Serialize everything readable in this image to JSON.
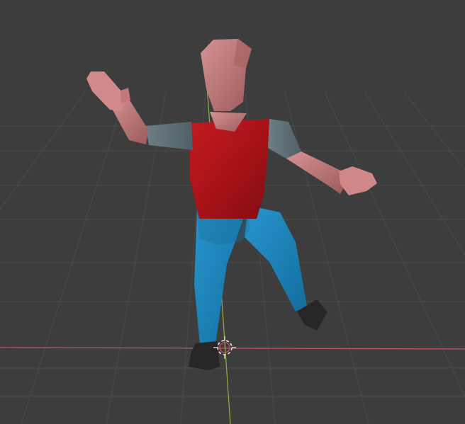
{
  "viewport": {
    "background": "#3d3d3d",
    "grid_color": "#4a4a4a",
    "x_axis_color": "#c05262",
    "y_axis_color": "#8fb33c"
  },
  "character": {
    "shirt_color": "#b3151b",
    "pants_color": "#1f86bf",
    "skin_color": "#c98283",
    "sleeve_color": "#5d7178",
    "shoe_color": "#262626"
  },
  "cursor": {
    "icon": "3d-cursor-icon"
  }
}
